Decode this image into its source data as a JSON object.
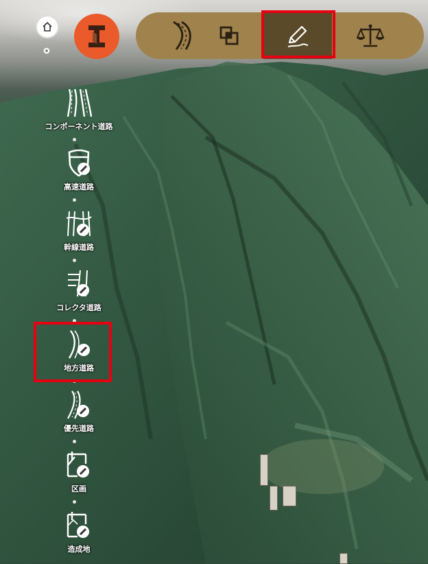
{
  "topbar": {
    "home_icon": "home-icon",
    "settings_icon": "gear-icon",
    "brand_icon": "infraworks-logo-icon",
    "tools": [
      {
        "name": "road-tool",
        "icon": "road-curve-icon"
      },
      {
        "name": "layers-tool",
        "icon": "overlap-squares-icon"
      },
      {
        "name": "design-tool",
        "icon": "pencil-icon",
        "active": true
      },
      {
        "name": "analysis-tool",
        "icon": "balance-scale-icon"
      }
    ]
  },
  "sidebar": {
    "items": [
      {
        "label": "コンポーネント道路",
        "icon": "component-road-icon"
      },
      {
        "label": "高速道路",
        "icon": "highway-icon"
      },
      {
        "label": "幹線道路",
        "icon": "arterial-road-icon"
      },
      {
        "label": "コレクタ道路",
        "icon": "collector-road-icon"
      },
      {
        "label": "地方道路",
        "icon": "local-road-icon",
        "highlighted": true
      },
      {
        "label": "優先道路",
        "icon": "priority-road-icon"
      },
      {
        "label": "区画",
        "icon": "parcel-icon"
      },
      {
        "label": "造成地",
        "icon": "grading-icon"
      }
    ]
  },
  "colors": {
    "toolbar_bg": "#a0824d",
    "toolbar_active": "#5b4a2a",
    "brand_orange": "#ea5a2a",
    "highlight_red": "#e60012"
  }
}
